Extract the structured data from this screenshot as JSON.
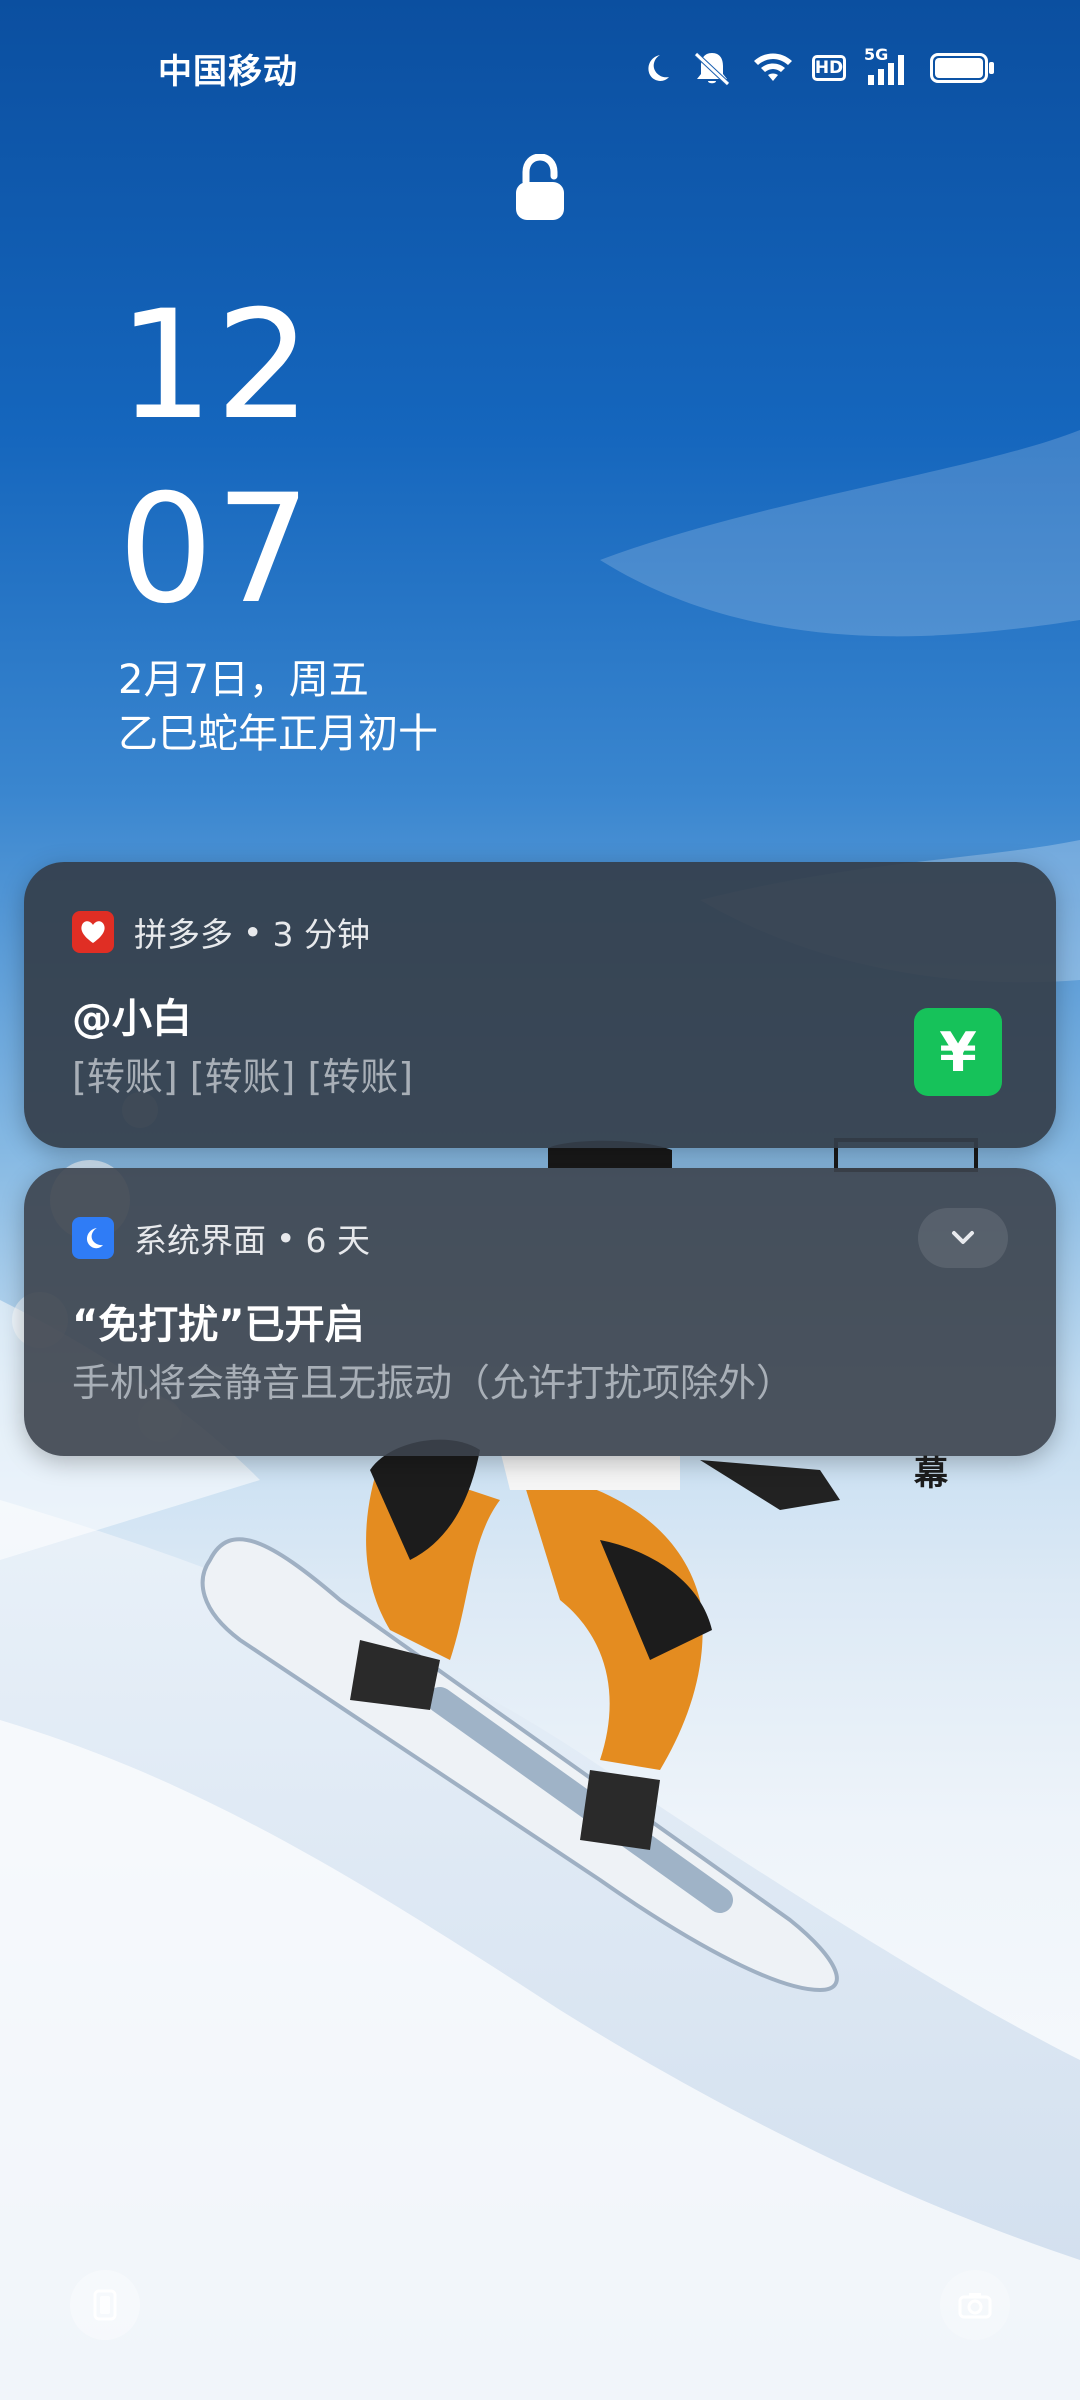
{
  "status_bar": {
    "carrier": "中国移动",
    "icons": [
      "moon-icon",
      "bell-muted-icon",
      "wifi-icon",
      "hd-icon",
      "5g-signal-icon",
      "battery-icon"
    ],
    "hd_label": "HD",
    "network_label": "5G"
  },
  "lock": {
    "icon": "lock-icon"
  },
  "clock": {
    "hour": "12",
    "minute": "07",
    "date": "2月7日，周五",
    "lunar": "乙巳蛇年正月初十"
  },
  "notifications": [
    {
      "app_name": "拼多多",
      "time": "3 分钟",
      "separator": "•",
      "title": "@小白",
      "body": "[转账] [转账] [转账]",
      "thumb_symbol": "¥",
      "app_color": "#e02e24",
      "thumb_color": "#16c25a"
    },
    {
      "app_name": "系统界面",
      "time": "6 天",
      "separator": "•",
      "title": "“免打扰”已开启",
      "body": "手机将会静音且无振动（允许打扰项除外）",
      "app_color": "#2f7cf6"
    }
  ],
  "wallpaper_text": "幕"
}
